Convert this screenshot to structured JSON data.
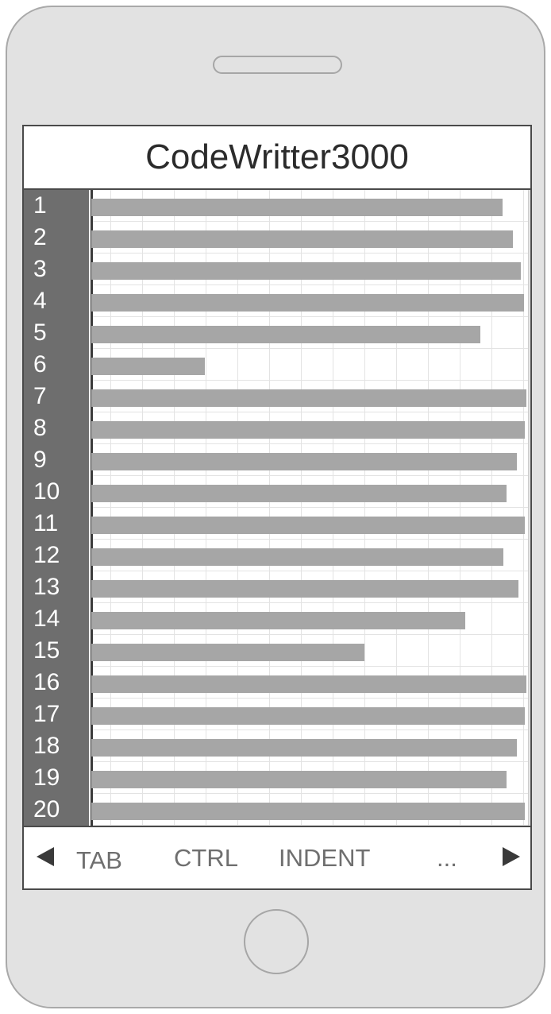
{
  "app": {
    "title": "CodeWritter3000"
  },
  "editor": {
    "lines": [
      {
        "number": "1",
        "fill": 0.946
      },
      {
        "number": "2",
        "fill": 0.969
      },
      {
        "number": "3",
        "fill": 0.987
      },
      {
        "number": "4",
        "fill": 0.995
      },
      {
        "number": "5",
        "fill": 0.895
      },
      {
        "number": "6",
        "fill": 0.261
      },
      {
        "number": "7",
        "fill": 1.0
      },
      {
        "number": "8",
        "fill": 0.996
      },
      {
        "number": "9",
        "fill": 0.978
      },
      {
        "number": "10",
        "fill": 0.955
      },
      {
        "number": "11",
        "fill": 0.996
      },
      {
        "number": "12",
        "fill": 0.947
      },
      {
        "number": "13",
        "fill": 0.982
      },
      {
        "number": "14",
        "fill": 0.859
      },
      {
        "number": "15",
        "fill": 0.628
      },
      {
        "number": "16",
        "fill": 1.0
      },
      {
        "number": "17",
        "fill": 0.996
      },
      {
        "number": "18",
        "fill": 0.978
      },
      {
        "number": "19",
        "fill": 0.955
      },
      {
        "number": "20",
        "fill": 0.996
      }
    ]
  },
  "toolbar": {
    "prev_icon": "left-arrow-icon",
    "next_icon": "right-arrow-icon",
    "tab_label": "TAB",
    "ctrl_label": "CTRL",
    "indent_label": "INDENT",
    "more_label": "..."
  },
  "colors": {
    "gutter": "#6e6e6e",
    "code_bar": "#a6a6a6",
    "phone_body": "#e2e2e2"
  }
}
